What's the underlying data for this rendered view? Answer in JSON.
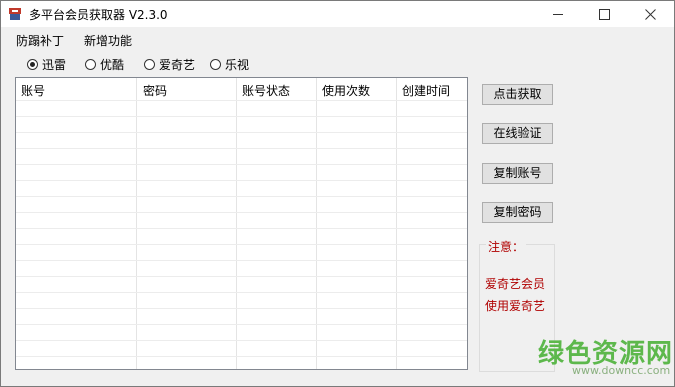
{
  "window": {
    "title": "多平台会员获取器 V2.3.0"
  },
  "menu": [
    "防蹋补丁",
    "新增功能"
  ],
  "platforms": [
    {
      "label": "迅雷",
      "selected": true
    },
    {
      "label": "优酷",
      "selected": false
    },
    {
      "label": "爱奇艺",
      "selected": false
    },
    {
      "label": "乐视",
      "selected": false
    }
  ],
  "table": {
    "columns": [
      "账号",
      "密码",
      "账号状态",
      "使用次数",
      "创建时间"
    ],
    "rows": []
  },
  "buttons": {
    "fetch": "点击获取",
    "verify": "在线验证",
    "copy_account": "复制账号",
    "copy_password": "复制密码"
  },
  "notice": {
    "title": "注意：",
    "lines": [
      "爱奇艺会员",
      "使用爱奇艺"
    ]
  },
  "watermark": {
    "name": "绿色资源网",
    "url": "www.downcc.com"
  },
  "colors": {
    "notice_text": "#b00000",
    "watermark": "#5db84c"
  }
}
